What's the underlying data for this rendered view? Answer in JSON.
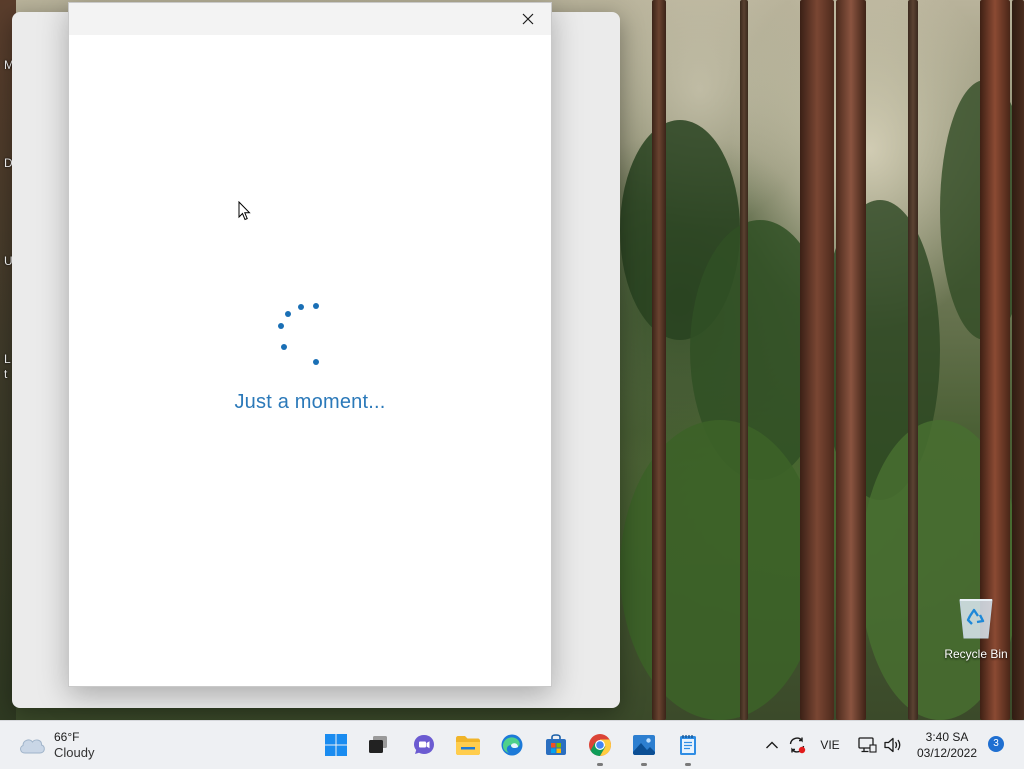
{
  "dialog": {
    "loading_text": "Just a moment..."
  },
  "desktop": {
    "left_edge_letters": [
      "M",
      "D",
      "U",
      "L",
      "t"
    ],
    "recycle_bin_label": "Recycle Bin"
  },
  "taskbar": {
    "weather": {
      "temperature": "66°F",
      "condition": "Cloudy",
      "icon": "cloud-icon"
    },
    "pinned_apps": [
      {
        "name": "Start",
        "icon": "windows-start-icon",
        "running": false
      },
      {
        "name": "Task View",
        "icon": "task-view-icon",
        "running": false
      },
      {
        "name": "Chat",
        "icon": "teams-chat-icon",
        "running": false
      },
      {
        "name": "File Explorer",
        "icon": "folder-icon",
        "running": false
      },
      {
        "name": "Microsoft Edge",
        "icon": "edge-icon",
        "running": false
      },
      {
        "name": "Microsoft Store",
        "icon": "store-icon",
        "running": false
      },
      {
        "name": "Google Chrome",
        "icon": "chrome-icon",
        "running": true
      },
      {
        "name": "Photos",
        "icon": "photos-icon",
        "running": true
      },
      {
        "name": "Notepad",
        "icon": "notepad-icon",
        "running": true
      }
    ],
    "tray": {
      "language": "VIE",
      "time": "3:40 SA",
      "date": "03/12/2022",
      "notification_count": "3"
    }
  },
  "colors": {
    "accent": "#1a6fb5",
    "loading_text": "#2b79b9",
    "taskbar_bg": "#eef0f3"
  }
}
